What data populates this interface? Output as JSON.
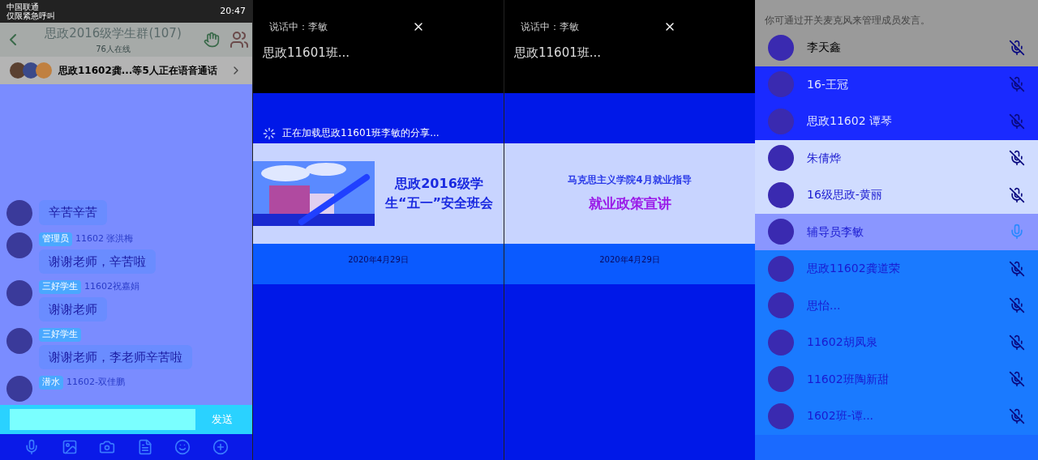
{
  "status_bar": {
    "carrier": "中国联通",
    "carrier_note": "仅限紧急呼叫",
    "time": "20:47"
  },
  "chat": {
    "title": "思政2016级学生群(107)",
    "online": "76人在线",
    "voice_banner": "思政11602龚...等5人正在语音通话",
    "messages": [
      {
        "text": "辛苦辛苦"
      },
      {
        "badge": "管理员",
        "sender": "11602 张洪梅",
        "text": "谢谢老师，辛苦啦"
      },
      {
        "badge": "三好学生",
        "sender": "11602祝嘉娟",
        "text": "谢谢老师"
      },
      {
        "badge": "三好学生",
        "text": "谢谢老师，李老师辛苦啦"
      },
      {
        "badge": "潜水",
        "sender": "11602-双佳鹏"
      }
    ],
    "send_button": "发送"
  },
  "shares": [
    {
      "speaking": "说话中：李敏",
      "group": "思政11601班...",
      "loading": "正在加载思政11601班李敏的分享...",
      "kind": "picture",
      "slide_title": "思政2016级学生“五一”安全班会",
      "date": "2020年4月29日"
    },
    {
      "speaking": "说话中：李敏",
      "group": "思政11601班...",
      "kind": "plain",
      "slide_subtitle": "马克思主义学院4月就业指导",
      "slide_title": "就业政策宣讲",
      "date": "2020年4月29日"
    }
  ],
  "members": {
    "hint": "你可通过开关麦克风来管理成员发言。",
    "items": [
      {
        "name": "李天鑫",
        "muted": true
      },
      {
        "name": "16-王冠",
        "muted": true
      },
      {
        "name": "思政11602 谭琴",
        "muted": true
      },
      {
        "name": "朱倩烨",
        "muted": true
      },
      {
        "name": "16级思政-黄丽",
        "muted": true
      },
      {
        "name": "辅导员李敏",
        "muted": false
      },
      {
        "name": "思政11602龚道荣",
        "muted": true
      },
      {
        "name": "思怡...",
        "muted": true
      },
      {
        "name": "11602胡凤泉",
        "muted": true
      },
      {
        "name": "11602班陶新甜",
        "muted": true
      },
      {
        "name": "1602班-谭...",
        "muted": true
      }
    ]
  }
}
